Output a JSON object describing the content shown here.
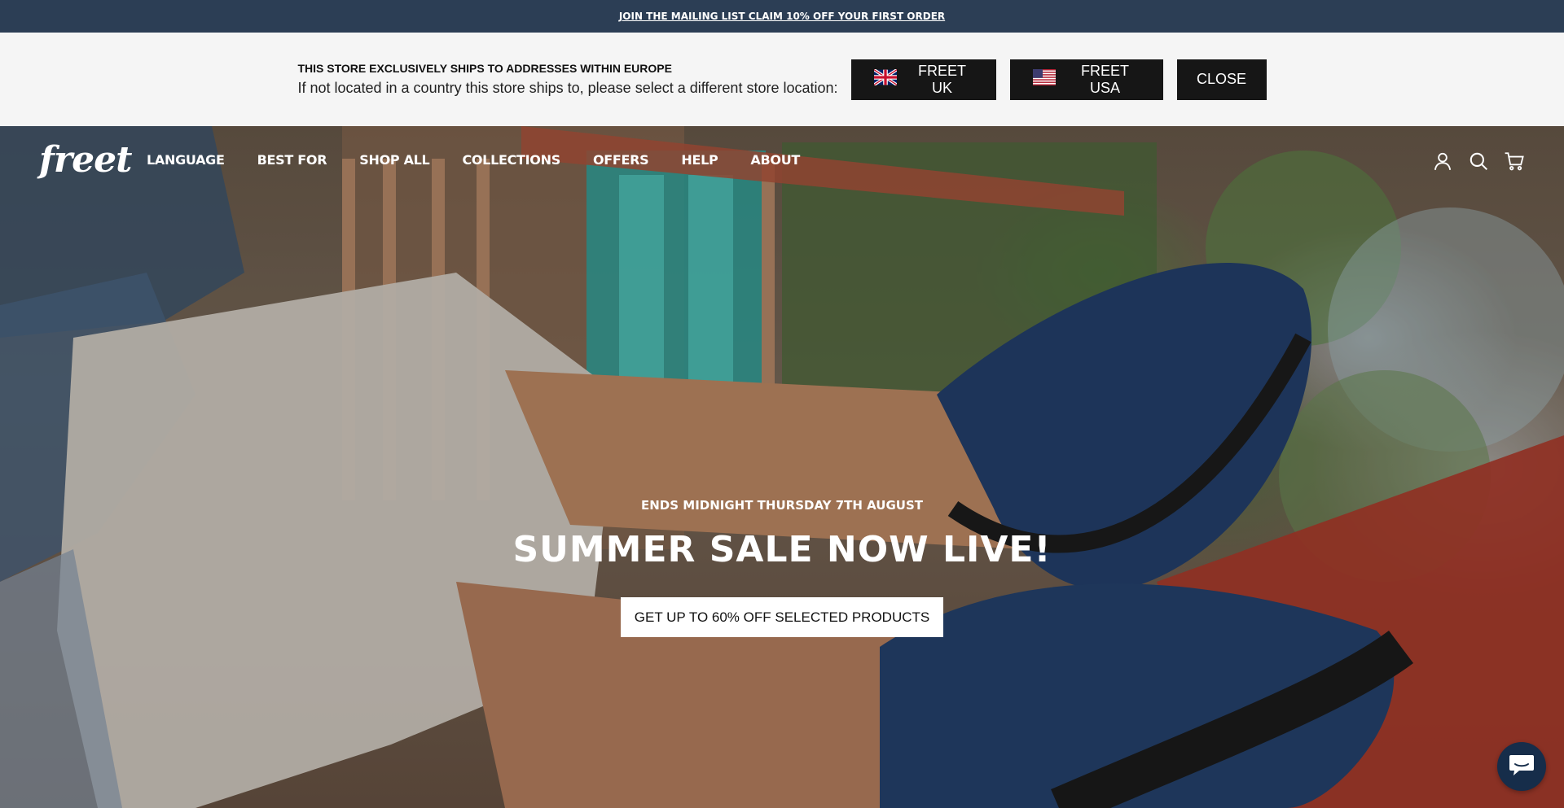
{
  "announcement": {
    "text": "JOIN THE MAILING LIST CLAIM 10% OFF YOUR FIRST ORDER"
  },
  "geo_banner": {
    "title": "THIS STORE EXCLUSIVELY SHIPS TO ADDRESSES WITHIN EUROPE",
    "subtitle": "If not located in a country this store ships to, please select a different store location:",
    "buttons": [
      {
        "label": "FREET UK",
        "icon": "uk-flag-icon"
      },
      {
        "label": "FREET USA",
        "icon": "us-flag-icon"
      },
      {
        "label": "CLOSE"
      }
    ]
  },
  "header": {
    "logo": "freet",
    "nav": [
      "LANGUAGE",
      "BEST FOR",
      "SHOP ALL",
      "COLLECTIONS",
      "OFFERS",
      "HELP",
      "ABOUT"
    ],
    "icons": [
      "account-icon",
      "search-icon",
      "cart-icon"
    ]
  },
  "hero": {
    "eyebrow": "ENDS MIDNIGHT THURSDAY 7TH AUGUST",
    "title": "SUMMER SALE NOW LIVE!",
    "cta": "GET UP TO 60% OFF SELECTED PRODUCTS"
  },
  "chat": {
    "icon": "chat-icon"
  },
  "colors": {
    "announcement_bg": "#2c3e55",
    "geo_bg": "#f5f5f5",
    "button_bg": "#161616",
    "chat_bg": "#162d4a"
  }
}
